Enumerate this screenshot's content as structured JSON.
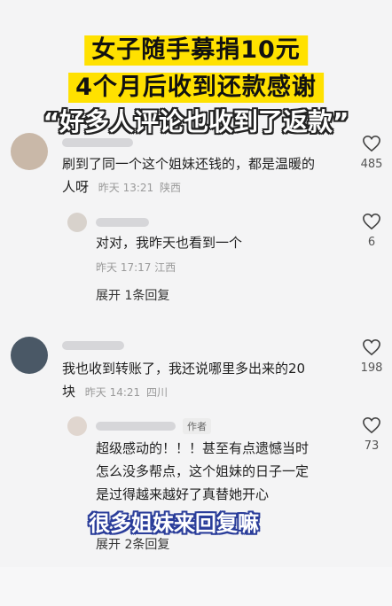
{
  "headline": {
    "line1": "女子随手募捐10元",
    "line2": "4个月后收到还款感谢",
    "quote": "“好多人评论也收到了返款”"
  },
  "comments": [
    {
      "text_line1": "刷到了同一个这个姐妹还钱的，都是温暖的",
      "text_line2": "人呀",
      "time": "昨天 13:21",
      "location": "陕西",
      "likes": "485"
    },
    {
      "text": "对对，我昨天也看到一个",
      "time": "昨天 17:17",
      "location": "江西",
      "likes": "6",
      "expand": "展开 1条回复"
    },
    {
      "text_line1": "我也收到转账了，我还说哪里多出来的20",
      "text_line2": "块",
      "time": "昨天 14:21",
      "location": "四川",
      "likes": "198"
    },
    {
      "author_tag": "作者",
      "text_line1": "超级感动的！！！甚至有点遗憾当时",
      "text_line2": "怎么没多帮点，这个姐妹的日子一定",
      "text_line3": "是过得越来越好了真替她开心",
      "likes": "73",
      "expand": "展开 2条回复"
    }
  ],
  "overlay_caption": "很多姐妹来回复嘛",
  "colors": {
    "headline_bg": "#ffe100",
    "caption_outline": "#2a3d9a",
    "meta": "#9a9a9a"
  },
  "icons": [
    "heart-icon"
  ]
}
